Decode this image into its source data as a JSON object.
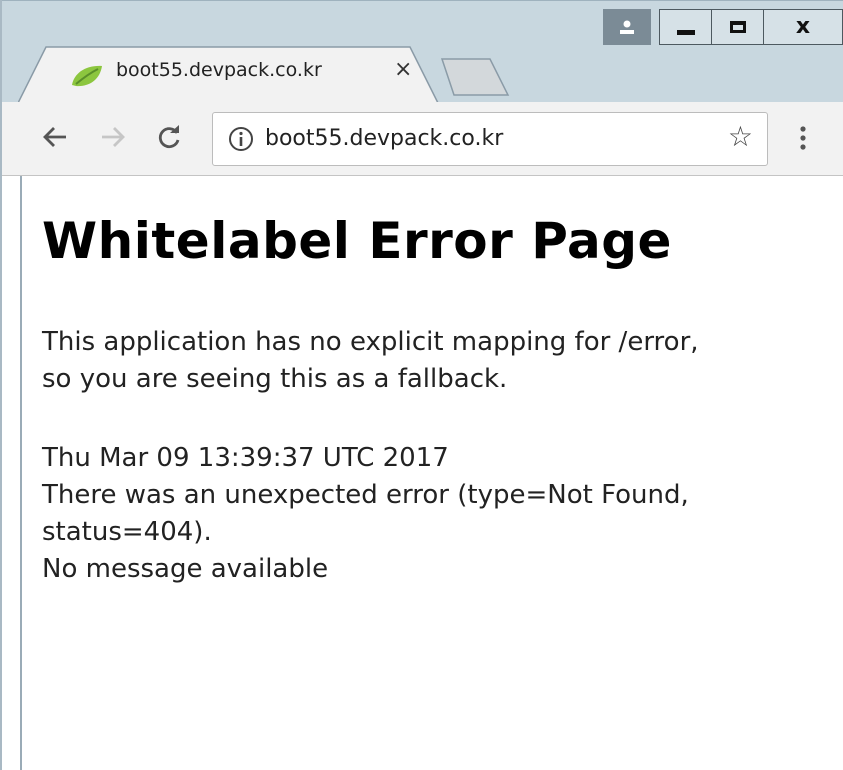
{
  "window": {
    "controls": {
      "profile_icon": "person-icon",
      "minimize_icon": "minimize-icon",
      "maximize_icon": "maximize-icon",
      "close_glyph": "x"
    }
  },
  "tabs": [
    {
      "title": "boot55.devpack.co.kr",
      "favicon": "spring-leaf-icon",
      "close_glyph": "×",
      "active": true
    }
  ],
  "toolbar": {
    "back_icon": "back-arrow-icon",
    "forward_icon": "forward-arrow-icon",
    "reload_icon": "reload-icon",
    "url": "boot55.devpack.co.kr",
    "info_icon": "info-icon",
    "star_glyph": "☆",
    "menu_icon": "more-vert-icon"
  },
  "page": {
    "heading": "Whitelabel Error Page",
    "paragraph1_line1": "This application has no explicit mapping for /error,",
    "paragraph1_line2": "so you are seeing this as a fallback.",
    "timestamp": "Thu Mar 09 13:39:37 UTC 2017",
    "error_line1": "There was an unexpected error (type=Not Found,",
    "error_line2": "status=404).",
    "message": "No message available"
  },
  "colors": {
    "titlebar": "#c8d7df",
    "toolbar": "#f2f2f2",
    "favicon_green": "#6db33f"
  }
}
